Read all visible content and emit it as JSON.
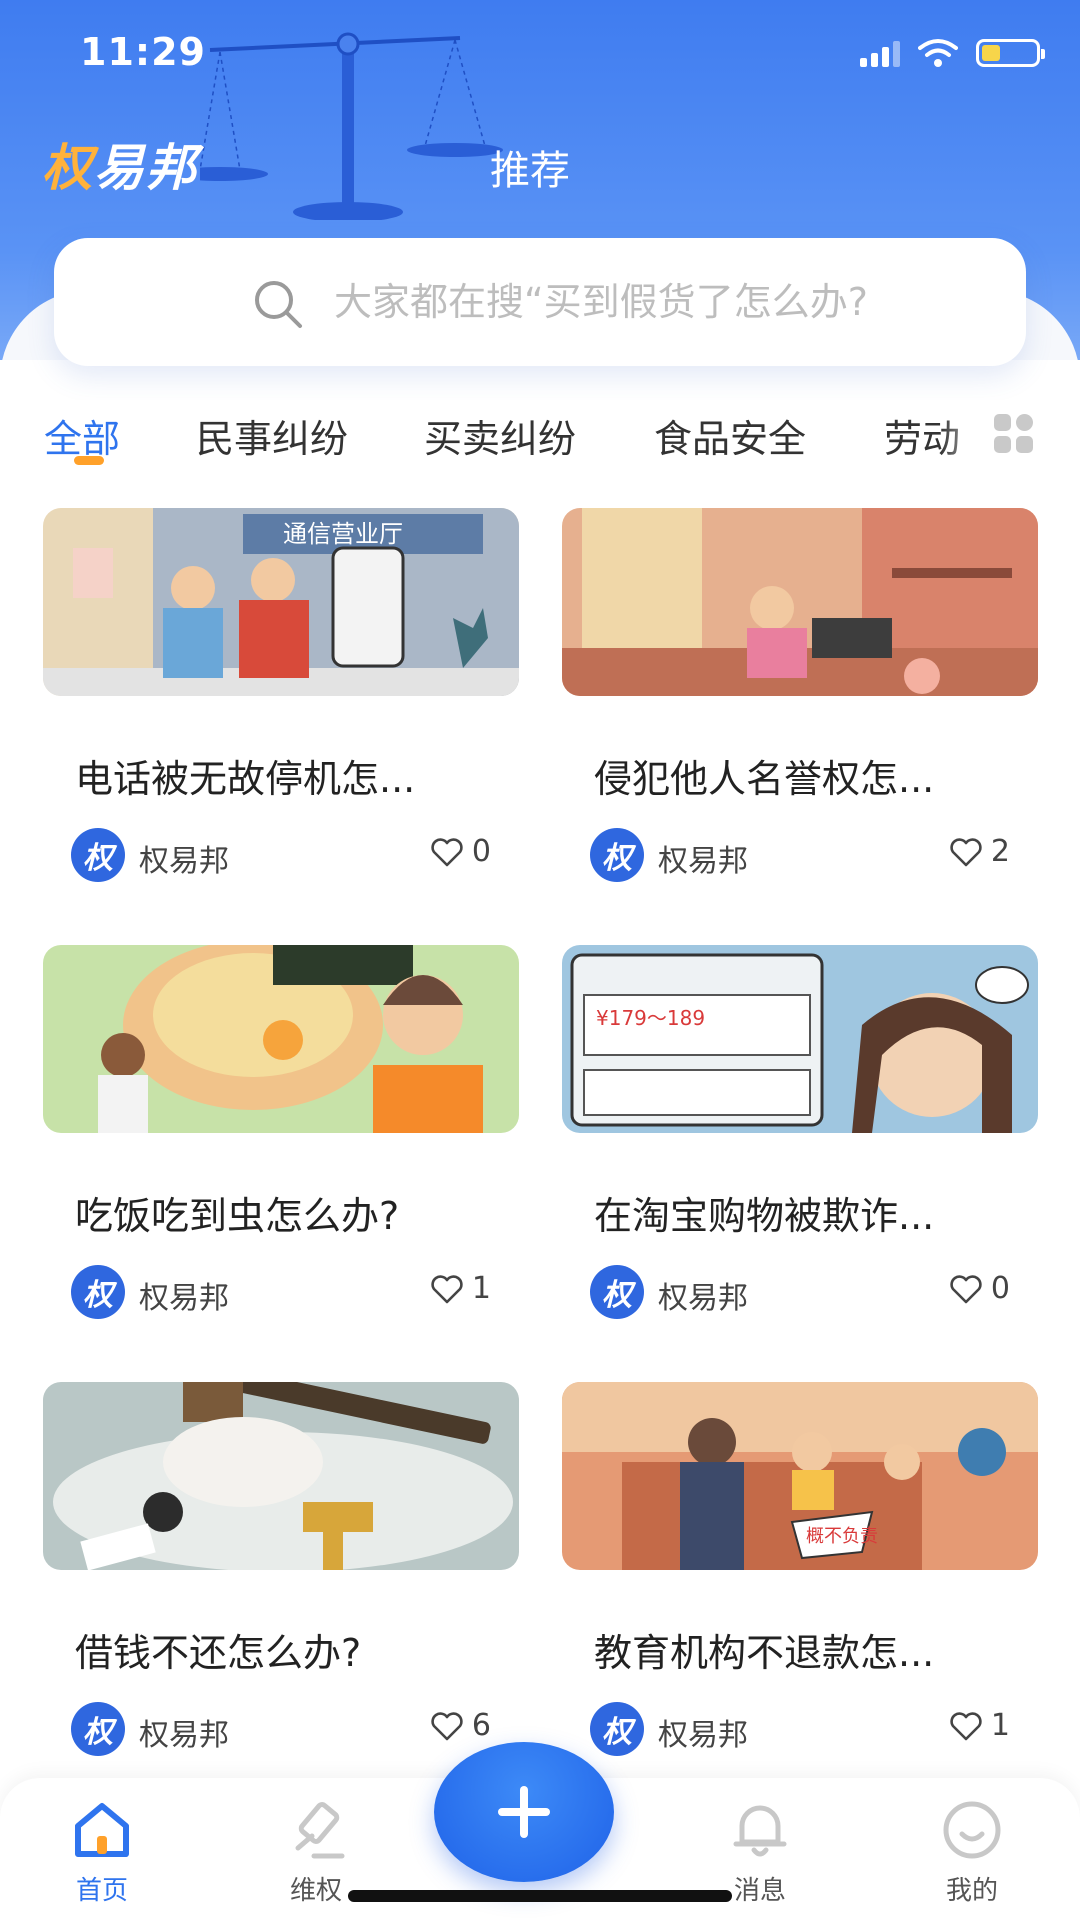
{
  "status_bar": {
    "time": "11:29"
  },
  "header": {
    "logo_main": "权",
    "logo_rest": "易邦",
    "section_title": "推荐"
  },
  "search": {
    "placeholder": "大家都在搜“买到假货了怎么办?"
  },
  "tabs": [
    {
      "label": "全部",
      "active": true
    },
    {
      "label": "民事纠纷",
      "active": false
    },
    {
      "label": "买卖纠纷",
      "active": false
    },
    {
      "label": "食品安全",
      "active": false
    },
    {
      "label": "劳动",
      "active": false
    }
  ],
  "cards": [
    {
      "title": "电话被无故停机怎...",
      "author": "权易邦",
      "likes": "0",
      "image_text": "通信营业厅"
    },
    {
      "title": "侵犯他人名誉权怎...",
      "author": "权易邦",
      "likes": "2",
      "image_text": ""
    },
    {
      "title": "吃饭吃到虫怎么办?",
      "author": "权易邦",
      "likes": "1",
      "image_text": ""
    },
    {
      "title": "在淘宝购物被欺诈...",
      "author": "权易邦",
      "likes": "0",
      "image_text": "¥179～189"
    },
    {
      "title": "借钱不还怎么办?",
      "author": "权易邦",
      "likes": "6",
      "image_text": ""
    },
    {
      "title": "教育机构不退款怎...",
      "author": "权易邦",
      "likes": "1",
      "image_text": "概不负责"
    }
  ],
  "avatar_text": {
    "main": "权",
    "rest": ""
  },
  "bottom_nav": [
    {
      "label": "首页",
      "icon": "home-icon",
      "active": true
    },
    {
      "label": "维权",
      "icon": "gavel-icon",
      "active": false
    },
    {
      "label": "消息",
      "icon": "bell-icon",
      "active": false
    },
    {
      "label": "我的",
      "icon": "smile-icon",
      "active": false
    }
  ],
  "colors": {
    "primary": "#2f74ee",
    "header": "#3f7cf0",
    "accent": "#ffa12a",
    "fab": "#1f62e8"
  }
}
